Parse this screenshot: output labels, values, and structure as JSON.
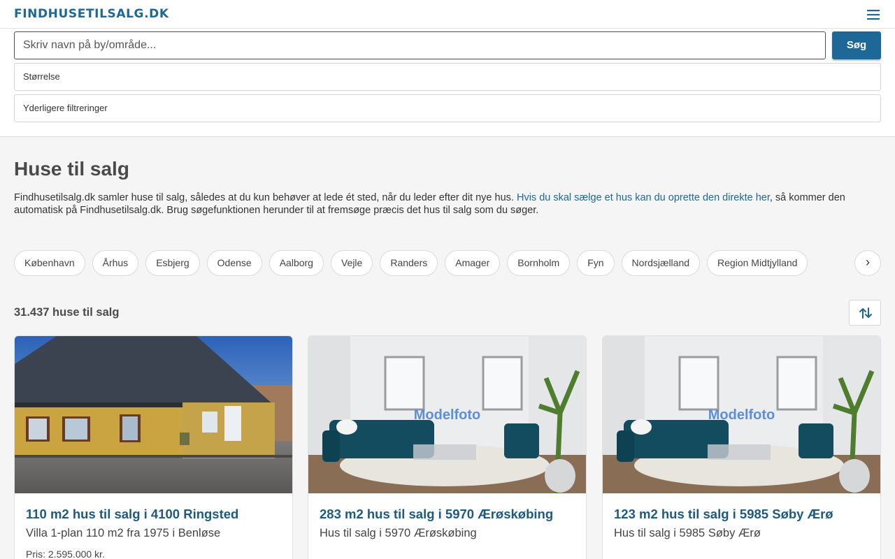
{
  "header": {
    "logo": "FINDHUSETILSALG.DK",
    "menu_icon": "hamburger-menu-icon"
  },
  "search": {
    "placeholder": "Skriv navn på by/område...",
    "button_label": "Søg",
    "filter_size_label": "Størrelse",
    "filter_more_label": "Yderligere filtreringer"
  },
  "main": {
    "title": "Huse til salg",
    "intro_before": "Findhusetilsalg.dk samler huse til salg, således at du kun behøver at lede ét sted, når du leder efter dit nye hus. ",
    "intro_link": "Hvis du skal sælge et hus kan du oprette den direkte her",
    "intro_after": ", så kommer den automatisk på Findhusetilsalg.dk. Brug søgefunktionen herunder til at fremsøge præcis det hus til salg som du søger."
  },
  "locations": [
    "København",
    "Århus",
    "Esbjerg",
    "Odense",
    "Aalborg",
    "Vejle",
    "Randers",
    "Amager",
    "Bornholm",
    "Fyn",
    "Nordsjælland",
    "Region Midtjylland"
  ],
  "locations_next": "›",
  "results": {
    "count_label": "31.437 huse til salg",
    "sort_icon": "sort-arrows-icon"
  },
  "listings": [
    {
      "title": "110 m2 hus til salg i 4100 Ringsted",
      "subtitle": "Villa 1-plan 110 m2 fra 1975 i Benløse",
      "price": "Pris: 2.595.000 kr.",
      "image_overlay": ""
    },
    {
      "title": "283 m2 hus til salg i 5970 Ærøskøbing",
      "subtitle": "Hus til salg i 5970 Ærøskøbing",
      "price": "",
      "image_overlay": "Modelfoto"
    },
    {
      "title": "123 m2 hus til salg i 5985 Søby Ærø",
      "subtitle": "Hus til salg i 5985 Søby Ærø",
      "price": "",
      "image_overlay": "Modelfoto"
    }
  ],
  "colors": {
    "brand": "#1d6897",
    "link": "#1d5a80",
    "page_bg": "#f5f5f5"
  }
}
